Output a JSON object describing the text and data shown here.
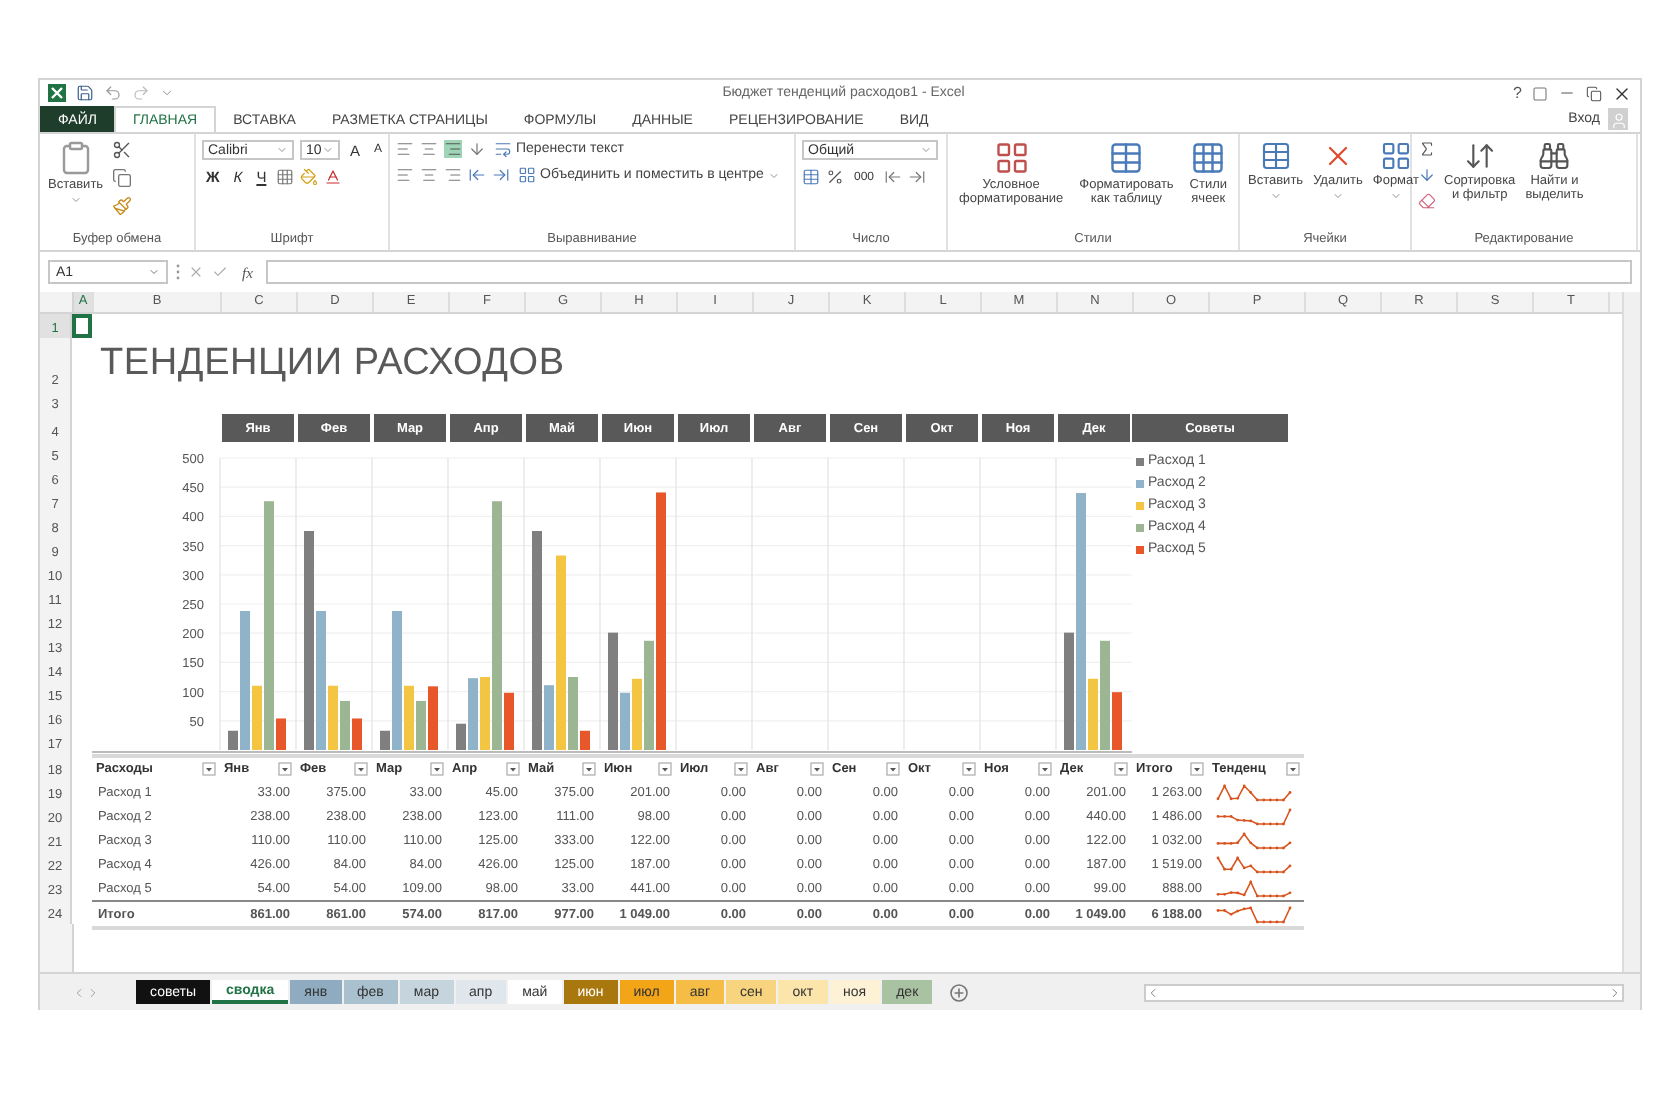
{
  "title_bar": {
    "title": "Бюджет тенденций расходов1 - Excel",
    "help": "?"
  },
  "ribbon_tabs": [
    {
      "label": "ФАЙЛ",
      "kind": "file",
      "selected": false
    },
    {
      "label": "ГЛАВНАЯ",
      "kind": "tab",
      "selected": true
    },
    {
      "label": "ВСТАВКА",
      "kind": "tab",
      "selected": false
    },
    {
      "label": "РАЗМЕТКА СТРАНИЦЫ",
      "kind": "tab",
      "selected": false
    },
    {
      "label": "ФОРМУЛЫ",
      "kind": "tab",
      "selected": false
    },
    {
      "label": "ДАННЫЕ",
      "kind": "tab",
      "selected": false
    },
    {
      "label": "РЕЦЕНЗИРОВАНИЕ",
      "kind": "tab",
      "selected": false
    },
    {
      "label": "ВИД",
      "kind": "tab",
      "selected": false
    }
  ],
  "sign_in": "Вход",
  "ribbon": {
    "clipboard": {
      "paste": "Вставить",
      "group": "Буфер обмена"
    },
    "font": {
      "name": "Calibri",
      "size": "10",
      "grow": "A",
      "shrink": "A",
      "bold": "Ж",
      "italic": "К",
      "underline": "Ч",
      "group": "Шрифт"
    },
    "alignment": {
      "wrap": "Перенести текст",
      "merge": "Объединить и поместить в центре",
      "group": "Выравнивание"
    },
    "number": {
      "format": "Общий",
      "thousands": "000",
      "group": "Число"
    },
    "styles": {
      "buttons": [
        {
          "lines": [
            "Условное",
            "форматирование"
          ]
        },
        {
          "lines": [
            "Форматировать",
            "как таблицу"
          ]
        },
        {
          "lines": [
            "Стили",
            "ячеек"
          ]
        }
      ],
      "group": "Стили"
    },
    "cells": {
      "buttons": [
        {
          "lines": [
            "Вставить"
          ]
        },
        {
          "lines": [
            "Удалить"
          ]
        },
        {
          "lines": [
            "Формат"
          ]
        }
      ],
      "group": "Ячейки"
    },
    "editing": {
      "buttons": [
        {
          "lines": [
            "Сортировка",
            "и фильтр"
          ]
        },
        {
          "lines": [
            "Найти и",
            "выделить"
          ]
        }
      ],
      "group": "Редактирование"
    }
  },
  "formula_bar": {
    "name_box": "A1",
    "fx": "fx"
  },
  "column_letters": [
    "A",
    "B",
    "C",
    "D",
    "E",
    "F",
    "G",
    "H",
    "I",
    "J",
    "K",
    "L",
    "M",
    "N",
    "O",
    "P",
    "Q",
    "R",
    "S",
    "T"
  ],
  "row_numbers": [
    "1",
    "2",
    "3",
    "4",
    "5",
    "6",
    "7",
    "8",
    "9",
    "10",
    "11",
    "12",
    "13",
    "14",
    "15",
    "16",
    "17",
    "18",
    "19",
    "20",
    "21",
    "22",
    "23",
    "24"
  ],
  "sheet": {
    "title": "ТЕНДЕНЦИИ РАСХОДОВ",
    "tips_header": "Советы",
    "month_headers": [
      "Янв",
      "Фев",
      "Мар",
      "Апр",
      "Май",
      "Июн",
      "Июл",
      "Авг",
      "Сен",
      "Окт",
      "Ноя",
      "Дек"
    ],
    "chart_data": {
      "type": "bar",
      "grid": true,
      "series": [
        {
          "name": "Расход 1",
          "color": "#7f7f7f",
          "values": [
            33,
            375,
            33,
            45,
            375,
            201,
            0,
            0,
            0,
            0,
            0,
            201
          ]
        },
        {
          "name": "Расход 2",
          "color": "#8fb4c9",
          "values": [
            238,
            238,
            238,
            123,
            111,
            98,
            0,
            0,
            0,
            0,
            0,
            440
          ]
        },
        {
          "name": "Расход 3",
          "color": "#f4c542",
          "values": [
            110,
            110,
            110,
            125,
            333,
            122,
            0,
            0,
            0,
            0,
            0,
            122
          ]
        },
        {
          "name": "Расход 4",
          "color": "#9cb592",
          "values": [
            426,
            84,
            84,
            426,
            125,
            187,
            0,
            0,
            0,
            0,
            0,
            187
          ]
        },
        {
          "name": "Расход 5",
          "color": "#e8572a",
          "values": [
            54,
            54,
            109,
            98,
            33,
            441,
            0,
            0,
            0,
            0,
            0,
            99
          ]
        }
      ],
      "ylim": [
        0,
        500
      ],
      "yticks": [
        50,
        100,
        150,
        200,
        250,
        300,
        350,
        400,
        450,
        500
      ]
    },
    "table": {
      "columns": [
        "Расходы",
        "Янв",
        "Фев",
        "Мар",
        "Апр",
        "Май",
        "Июн",
        "Июл",
        "Авг",
        "Сен",
        "Окт",
        "Ноя",
        "Дек",
        "Итого",
        "Тенденц"
      ],
      "rows": [
        {
          "kind": "item",
          "cells": [
            "Расход 1",
            "33.00",
            "375.00",
            "33.00",
            "45.00",
            "375.00",
            "201.00",
            "0.00",
            "0.00",
            "0.00",
            "0.00",
            "0.00",
            "201.00",
            "1 263.00"
          ]
        },
        {
          "kind": "item",
          "cells": [
            "Расход 2",
            "238.00",
            "238.00",
            "238.00",
            "123.00",
            "111.00",
            "98.00",
            "0.00",
            "0.00",
            "0.00",
            "0.00",
            "0.00",
            "440.00",
            "1 486.00"
          ]
        },
        {
          "kind": "item",
          "cells": [
            "Расход 3",
            "110.00",
            "110.00",
            "110.00",
            "125.00",
            "333.00",
            "122.00",
            "0.00",
            "0.00",
            "0.00",
            "0.00",
            "0.00",
            "122.00",
            "1 032.00"
          ]
        },
        {
          "kind": "item",
          "cells": [
            "Расход 4",
            "426.00",
            "84.00",
            "84.00",
            "426.00",
            "125.00",
            "187.00",
            "0.00",
            "0.00",
            "0.00",
            "0.00",
            "0.00",
            "187.00",
            "1 519.00"
          ]
        },
        {
          "kind": "item",
          "cells": [
            "Расход 5",
            "54.00",
            "54.00",
            "109.00",
            "98.00",
            "33.00",
            "441.00",
            "0.00",
            "0.00",
            "0.00",
            "0.00",
            "0.00",
            "99.00",
            "888.00"
          ]
        },
        {
          "kind": "total",
          "cells": [
            "Итого",
            "861.00",
            "861.00",
            "574.00",
            "817.00",
            "977.00",
            "1 049.00",
            "0.00",
            "0.00",
            "0.00",
            "0.00",
            "0.00",
            "1 049.00",
            "6 188.00"
          ]
        }
      ]
    }
  },
  "sheet_tabs": [
    {
      "label": "советы",
      "color": "#111111",
      "selected": false
    },
    {
      "label": "сводка",
      "selected": true
    },
    {
      "label": "янв",
      "color": "#8eabbf",
      "selected": false
    },
    {
      "label": "фев",
      "color": "#a9c0ce",
      "selected": false
    },
    {
      "label": "мар",
      "color": "#c6d4de",
      "selected": false
    },
    {
      "label": "апр",
      "color": "#dfe7ec",
      "selected": false
    },
    {
      "label": "май",
      "color": "#ffffff",
      "selected": false
    },
    {
      "label": "июн",
      "color": "#a8780f",
      "selected": false
    },
    {
      "label": "июл",
      "color": "#f2a516",
      "selected": false
    },
    {
      "label": "авг",
      "color": "#f5bd45",
      "selected": false
    },
    {
      "label": "сен",
      "color": "#f8d47f",
      "selected": false
    },
    {
      "label": "окт",
      "color": "#fbe5aa",
      "selected": false
    },
    {
      "label": "ноя",
      "color": "#fdf2d6",
      "selected": false
    },
    {
      "label": "дек",
      "color": "#a9c2a1",
      "selected": false
    }
  ]
}
